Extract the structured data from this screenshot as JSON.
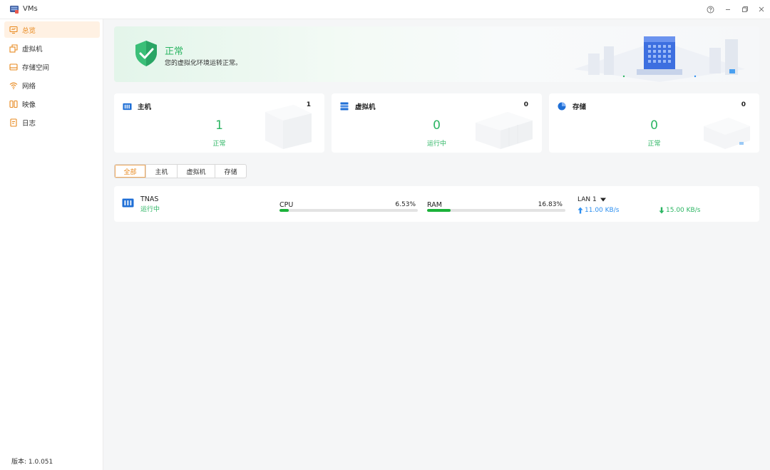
{
  "window": {
    "title": "VMs"
  },
  "sidebar": {
    "items": [
      {
        "label": "总览",
        "icon": "monitor-icon"
      },
      {
        "label": "虚拟机",
        "icon": "vm-stack-icon"
      },
      {
        "label": "存储空间",
        "icon": "drive-icon"
      },
      {
        "label": "网络",
        "icon": "wifi-icon"
      },
      {
        "label": "映像",
        "icon": "image-icon"
      },
      {
        "label": "日志",
        "icon": "log-icon"
      }
    ],
    "active_index": 0,
    "version": "版本: 1.0.051"
  },
  "banner": {
    "title": "正常",
    "subtitle": "您的虚拟化环境运转正常。"
  },
  "cards": [
    {
      "title": "主机",
      "count": "1",
      "number": "1",
      "status": "正常",
      "icon": "host-icon"
    },
    {
      "title": "虚拟机",
      "count": "0",
      "number": "0",
      "status": "运行中",
      "icon": "server-icon"
    },
    {
      "title": "存储",
      "count": "0",
      "number": "0",
      "status": "正常",
      "icon": "pie-icon"
    }
  ],
  "tabs": [
    {
      "label": "全部",
      "active": true
    },
    {
      "label": "主机",
      "active": false
    },
    {
      "label": "虚拟机",
      "active": false
    },
    {
      "label": "存储",
      "active": false
    }
  ],
  "vm_row": {
    "name": "TNAS",
    "state": "运行中",
    "cpu": {
      "label": "CPU",
      "value": "6.53%",
      "fraction": 0.0653
    },
    "ram": {
      "label": "RAM",
      "value": "16.83%",
      "fraction": 0.1683
    },
    "lan": {
      "label": "LAN 1",
      "upload": "11.00 KB/s",
      "download": "15.00 KB/s"
    }
  },
  "colors": {
    "accent": "#e8891e",
    "success": "#2cb563",
    "bar": "#1bb13a",
    "link": "#2d8ff0",
    "icon_blue": "#1f6fd6"
  }
}
